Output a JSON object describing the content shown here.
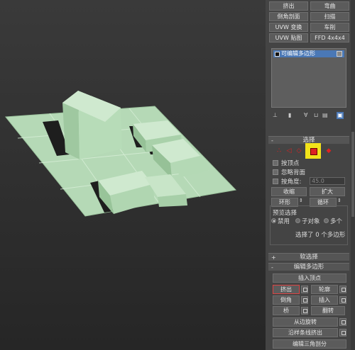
{
  "viewport": {
    "name": "perspective-viewport"
  },
  "top_buttons": [
    [
      "挤出",
      "弯曲"
    ],
    [
      "倒角剖面",
      "扫描"
    ],
    [
      "UVW 变换",
      "车削"
    ],
    [
      "UVW 贴图",
      "FFD 4x4x4"
    ]
  ],
  "stack": {
    "selected": "可编辑多边形"
  },
  "selection": {
    "title": "选择",
    "by_vertex": "按顶点",
    "ignore_backfacing": "忽略背面",
    "by_angle": "按角度:",
    "angle_value": "45.0",
    "shrink": "收缩",
    "grow": "扩大",
    "ring": "环形",
    "loop": "循环",
    "preview_title": "预览选择",
    "preview_options": [
      "禁用",
      "子对象",
      "多个"
    ],
    "status": "选择了 0 个多边形"
  },
  "soft_selection": {
    "title": "软选择"
  },
  "edit_poly": {
    "title": "编辑多边形",
    "insert_vertex": "插入顶点",
    "extrude": "挤出",
    "outline": "轮廓",
    "bevel": "倒角",
    "inset": "插入",
    "bridge": "桥",
    "flip": "翻转",
    "hinge_from_edge": "从边旋转",
    "extrude_along_spline": "沿样条线挤出",
    "edit_triangulation": "编辑三角剖分"
  },
  "colors": {
    "accent_red": "#dd2222",
    "highlight_yellow": "#f2e21a",
    "selection_blue": "#4a78b6",
    "mesh_green": "#bfe0c0"
  }
}
